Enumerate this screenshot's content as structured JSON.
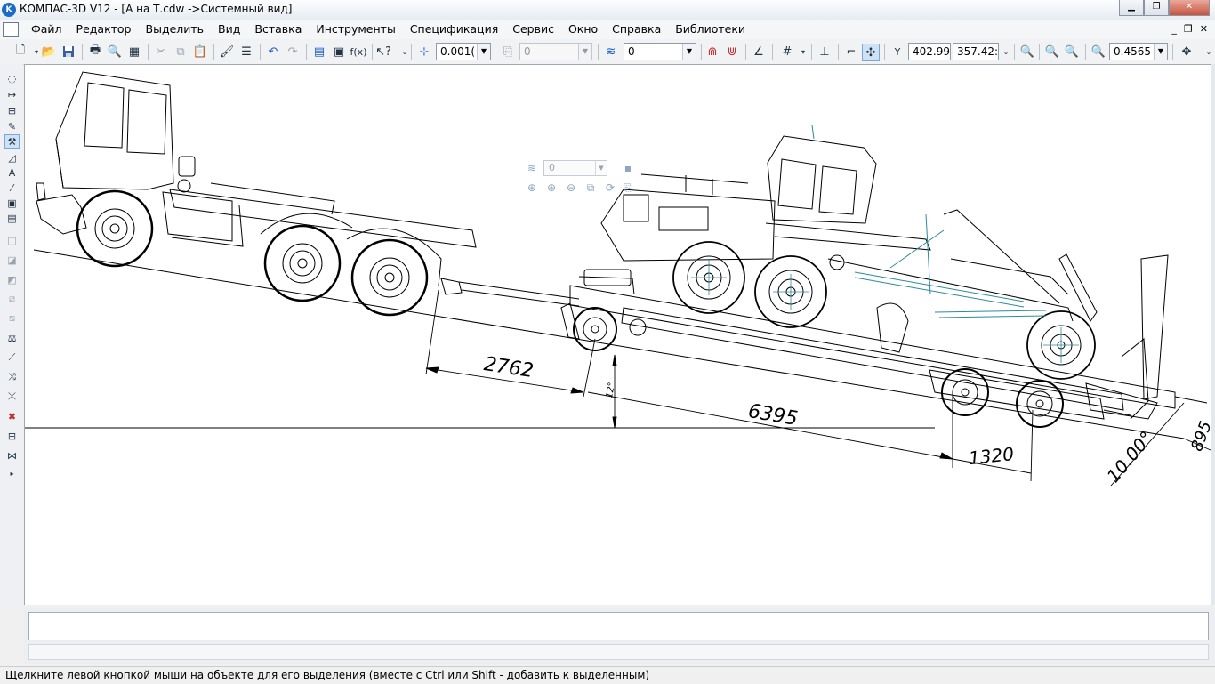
{
  "window": {
    "app_icon_text": "K",
    "title": "КОМПАС-3D V12 - [А на Т.cdw ->Системный вид]",
    "minimize": "▁",
    "restore": "❐",
    "close": "✕"
  },
  "menu": {
    "items": [
      "Файл",
      "Редактор",
      "Выделить",
      "Вид",
      "Вставка",
      "Инструменты",
      "Спецификация",
      "Сервис",
      "Окно",
      "Справка",
      "Библиотеки"
    ],
    "mdi_buttons": [
      "_",
      "❐",
      "✕"
    ]
  },
  "toolbar": {
    "step_value": "0.001(",
    "angle_value": "0",
    "layer_value": "0",
    "coord_label": "Y",
    "coord_x": "402.99:",
    "coord_y": "357.42:",
    "zoom_value": "0.4565"
  },
  "float_panel": {
    "layer_value": "0"
  },
  "drawing": {
    "dimensions": {
      "d2762": "2762",
      "d6395": "6395",
      "d1320": "1320",
      "d895": "895",
      "d10": "10.00°",
      "d12": "12°"
    }
  },
  "status": {
    "text": "Щелкните левой кнопкой мыши на объекте для его выделения (вместе с Ctrl или Shift - добавить к выделенным)"
  },
  "icons": {
    "new": "new-document-icon",
    "open": "open-folder-icon",
    "save": "save-icon",
    "print": "print-icon",
    "undo": "undo-icon",
    "redo": "redo-icon",
    "zoom": "zoom-icon",
    "pan": "pan-icon"
  }
}
